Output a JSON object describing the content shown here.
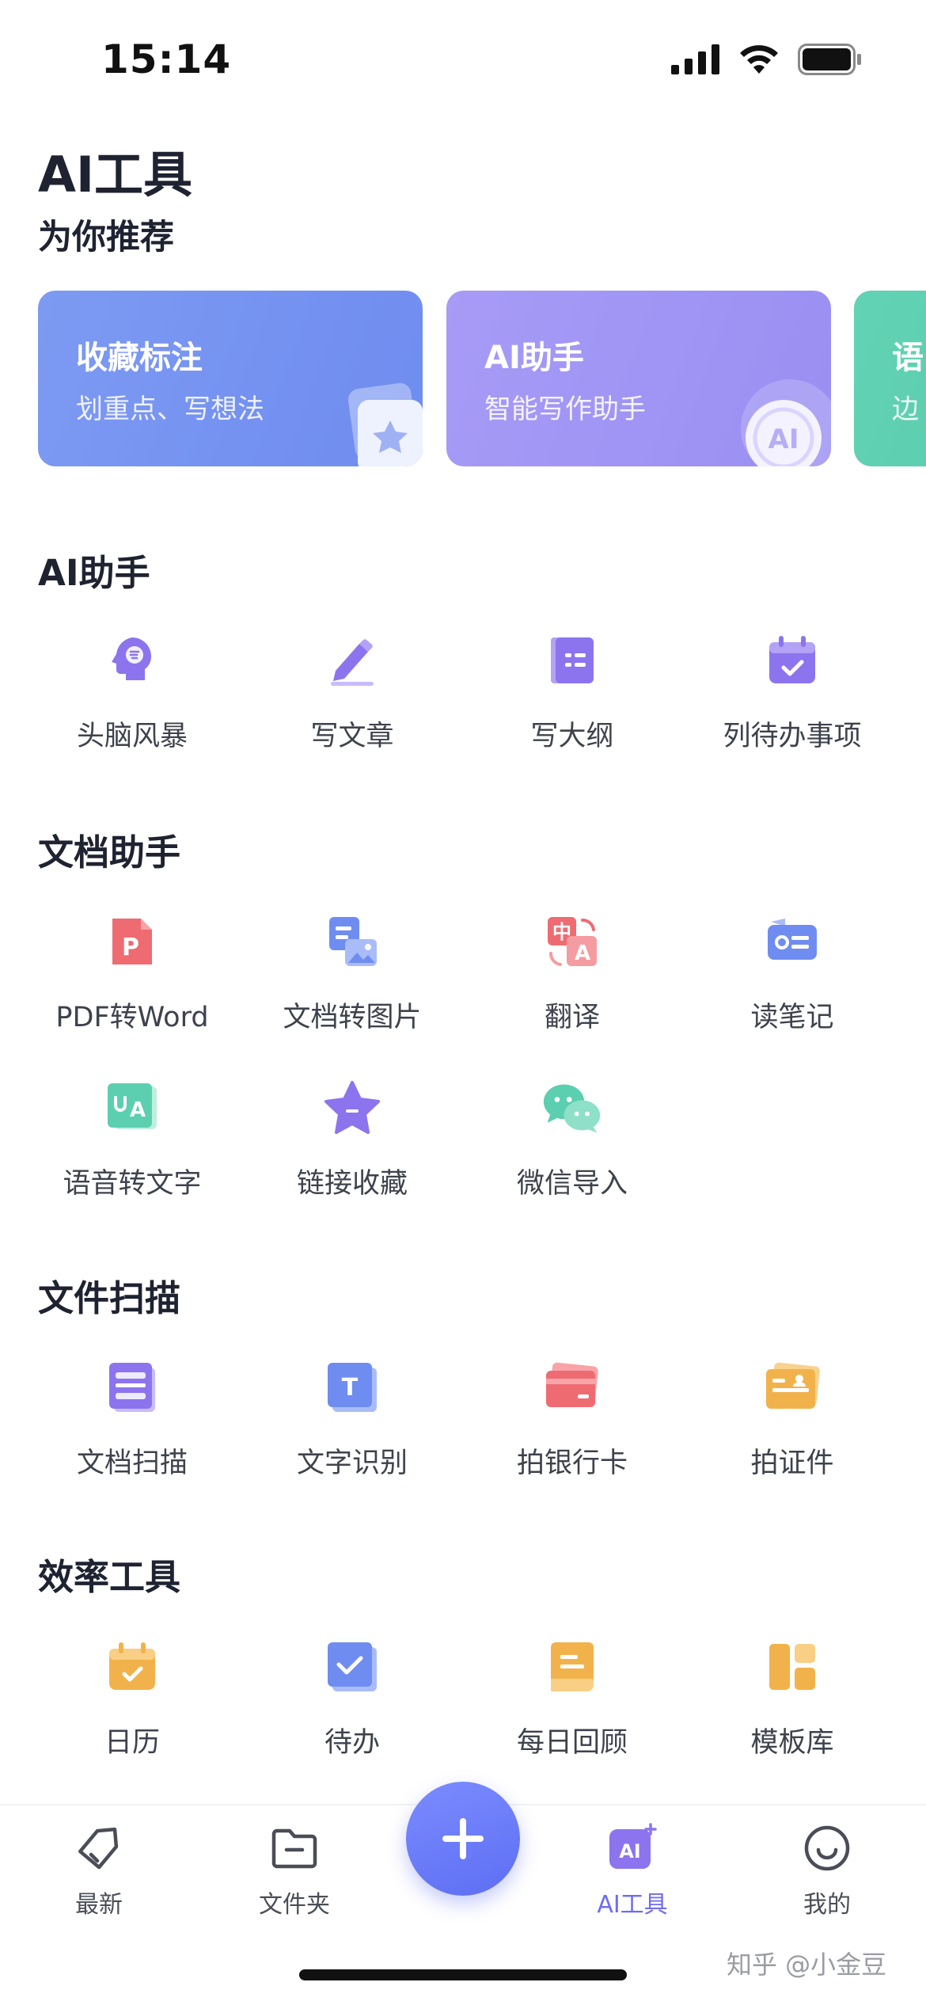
{
  "status_bar": {
    "time": "15:14"
  },
  "page_title": "AI工具",
  "page_subtitle": "为你推荐",
  "recommend_cards": [
    {
      "title": "收藏标注",
      "desc": "划重点、写想法",
      "art_icon": "star-card-icon"
    },
    {
      "title": "AI助手",
      "desc": "智能写作助手",
      "art_icon": "ai-badge-icon",
      "art_text": "AI"
    },
    {
      "title": "语",
      "desc": "边"
    }
  ],
  "sections": {
    "ai_assistant": {
      "title": "AI助手",
      "items": [
        {
          "label": "头脑风暴",
          "icon": "brain-icon"
        },
        {
          "label": "写文章",
          "icon": "pencil-icon"
        },
        {
          "label": "写大纲",
          "icon": "outline-icon"
        },
        {
          "label": "列待办事项",
          "icon": "calendar-check-icon"
        }
      ]
    },
    "doc_assistant": {
      "title": "文档助手",
      "items": [
        {
          "label": "PDF转Word",
          "icon": "pdf-icon",
          "glyph": "P"
        },
        {
          "label": "文档转图片",
          "icon": "doc-to-image-icon"
        },
        {
          "label": "翻译",
          "icon": "translate-icon",
          "glyph_a": "中",
          "glyph_b": "A"
        },
        {
          "label": "读笔记",
          "icon": "read-note-icon"
        },
        {
          "label": "语音转文字",
          "icon": "speech-to-text-icon",
          "glyph": "A"
        },
        {
          "label": "链接收藏",
          "icon": "link-star-icon"
        },
        {
          "label": "微信导入",
          "icon": "wechat-icon"
        }
      ]
    },
    "file_scan": {
      "title": "文件扫描",
      "items": [
        {
          "label": "文档扫描",
          "icon": "doc-scan-icon"
        },
        {
          "label": "文字识别",
          "icon": "text-ocr-icon",
          "glyph": "T"
        },
        {
          "label": "拍银行卡",
          "icon": "bank-card-icon"
        },
        {
          "label": "拍证件",
          "icon": "id-card-icon"
        }
      ]
    },
    "efficiency": {
      "title": "效率工具",
      "items": [
        {
          "label": "日历",
          "icon": "calendar-icon"
        },
        {
          "label": "待办",
          "icon": "todo-check-icon"
        },
        {
          "label": "每日回顾",
          "icon": "daily-review-icon"
        },
        {
          "label": "模板库",
          "icon": "template-icon"
        }
      ]
    }
  },
  "tab_bar": {
    "tabs": [
      {
        "label": "最新",
        "icon": "tag-icon"
      },
      {
        "label": "文件夹",
        "icon": "folder-icon"
      },
      {
        "label": "AI工具",
        "icon": "ai-tools-icon",
        "active": true,
        "icon_text": "AI"
      },
      {
        "label": "我的",
        "icon": "smile-icon"
      }
    ],
    "fab_icon": "plus-icon"
  },
  "watermark": "知乎 @小金豆",
  "colors": {
    "accent": "#6f6cf0",
    "card_blue": "#7e9cf3",
    "card_purple": "#a49af5",
    "card_green": "#5ccfb0",
    "pdf_red": "#ef6b72",
    "scan_orange": "#f2b24b"
  }
}
